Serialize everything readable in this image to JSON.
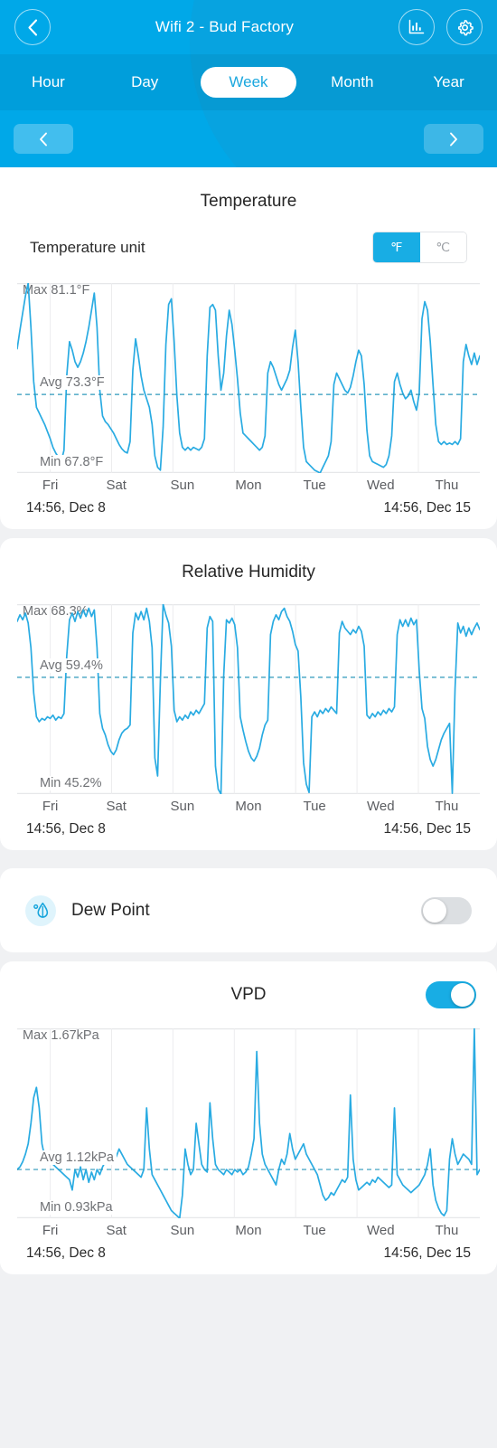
{
  "header": {
    "title": "Wifi 2 - Bud Factory",
    "back_icon": "chevron-left-icon",
    "stats_icon": "bar-chart-icon",
    "settings_icon": "gear-icon",
    "accent": "#00a8e8"
  },
  "tabs": [
    {
      "label": "Hour",
      "active": false
    },
    {
      "label": "Day",
      "active": false
    },
    {
      "label": "Week",
      "active": true
    },
    {
      "label": "Month",
      "active": false
    },
    {
      "label": "Year",
      "active": false
    }
  ],
  "date_nav": {
    "prev_icon": "chevron-left-icon",
    "next_icon": "chevron-right-icon"
  },
  "temperature": {
    "title": "Temperature",
    "unit_label": "Temperature unit",
    "unit_options": [
      {
        "label": "℉",
        "selected": true
      },
      {
        "label": "℃",
        "selected": false
      }
    ],
    "max": "Max 81.1°F",
    "avg": "Avg 73.3°F",
    "min": "Min 67.8°F",
    "start_stamp": "14:56,  Dec 8",
    "end_stamp": "14:56,  Dec 15"
  },
  "humidity": {
    "title": "Relative Humidity",
    "max": "Max 68.3%",
    "avg": "Avg 59.4%",
    "min": "Min 45.2%",
    "start_stamp": "14:56,  Dec 8",
    "end_stamp": "14:56,  Dec 15"
  },
  "dew_point": {
    "label": "Dew Point",
    "icon": "dew-drop-icon",
    "enabled": false
  },
  "vpd": {
    "title": "VPD",
    "enabled": true,
    "max": "Max 1.67kPa",
    "avg": "Avg 1.12kPa",
    "min": "Min 0.93kPa",
    "start_stamp": "14:56,  Dec 8",
    "end_stamp": "14:56,  Dec 15"
  },
  "day_labels": [
    "Fri",
    "Sat",
    "Sun",
    "Mon",
    "Tue",
    "Wed",
    "Thu"
  ],
  "chart_data": [
    {
      "id": "temperature",
      "type": "line",
      "title": "Temperature",
      "unit": "°F",
      "xlabel": "",
      "ylabel": "",
      "x_tick_labels": [
        "Fri",
        "Sat",
        "Sun",
        "Mon",
        "Tue",
        "Wed",
        "Thu"
      ],
      "x_range": [
        "14:56, Dec 8",
        "14:56, Dec 15"
      ],
      "max": 81.1,
      "avg": 73.3,
      "min": 67.8,
      "ylim": [
        67.8,
        81.1
      ],
      "grid": true,
      "avg_line": true,
      "legend": "none",
      "line_color": "#29ABE2",
      "values": [
        76.5,
        77.8,
        79.0,
        80.2,
        81.1,
        78.0,
        74.2,
        72.4,
        72.0,
        71.6,
        71.2,
        70.7,
        70.2,
        69.6,
        69.2,
        68.9,
        68.6,
        69.4,
        74.6,
        77.0,
        76.4,
        75.6,
        75.2,
        75.6,
        76.2,
        77.0,
        78.0,
        79.2,
        80.4,
        78.0,
        73.6,
        71.8,
        71.4,
        71.2,
        70.9,
        70.6,
        70.2,
        69.8,
        69.5,
        69.3,
        69.2,
        70.0,
        75.0,
        77.2,
        76.0,
        74.6,
        73.6,
        73.0,
        72.4,
        71.2,
        69.0,
        68.2,
        68.0,
        71.0,
        76.8,
        79.6,
        80.0,
        77.0,
        73.2,
        70.6,
        69.6,
        69.4,
        69.6,
        69.4,
        69.6,
        69.5,
        69.4,
        69.6,
        70.2,
        76.0,
        79.4,
        79.6,
        79.2,
        76.0,
        73.6,
        74.8,
        77.4,
        79.2,
        78.2,
        76.4,
        74.4,
        72.0,
        70.6,
        70.4,
        70.2,
        70.0,
        69.8,
        69.6,
        69.4,
        69.6,
        70.4,
        74.8,
        75.6,
        75.2,
        74.6,
        74.0,
        73.6,
        74.0,
        74.4,
        75.0,
        76.6,
        77.8,
        75.6,
        72.4,
        69.6,
        68.6,
        68.4,
        68.2,
        68.0,
        67.9,
        67.8,
        68.2,
        68.6,
        69.0,
        70.0,
        74.0,
        74.8,
        74.4,
        74.0,
        73.6,
        73.4,
        73.8,
        74.6,
        75.6,
        76.4,
        76.0,
        74.0,
        70.8,
        69.0,
        68.6,
        68.5,
        68.4,
        68.3,
        68.2,
        68.4,
        69.0,
        70.4,
        74.2,
        74.8,
        74.0,
        73.4,
        73.0,
        73.2,
        73.6,
        72.8,
        72.2,
        73.4,
        78.6,
        79.8,
        79.2,
        77.0,
        74.0,
        71.2,
        70.0,
        69.8,
        70.0,
        69.8,
        69.9,
        69.8,
        70.0,
        69.8,
        70.2,
        75.6,
        76.8,
        76.0,
        75.4,
        76.2,
        75.4,
        76.0
      ]
    },
    {
      "id": "relative_humidity",
      "type": "line",
      "title": "Relative Humidity",
      "unit": "%",
      "xlabel": "",
      "ylabel": "",
      "x_tick_labels": [
        "Fri",
        "Sat",
        "Sun",
        "Mon",
        "Tue",
        "Wed",
        "Thu"
      ],
      "x_range": [
        "14:56, Dec 8",
        "14:56, Dec 15"
      ],
      "max": 68.3,
      "avg": 59.4,
      "min": 45.2,
      "ylim": [
        45.2,
        68.3
      ],
      "grid": true,
      "avg_line": true,
      "legend": "none",
      "line_color": "#29ABE2",
      "values": [
        66.2,
        67.0,
        66.4,
        67.2,
        66.0,
        63.0,
        57.5,
        54.6,
        54.0,
        54.4,
        54.2,
        54.6,
        54.4,
        54.8,
        54.2,
        54.6,
        54.4,
        55.0,
        62.0,
        66.4,
        67.2,
        66.2,
        67.4,
        66.6,
        67.6,
        66.8,
        67.8,
        66.8,
        67.6,
        63.0,
        55.0,
        53.2,
        52.4,
        51.2,
        50.4,
        50.0,
        50.6,
        51.8,
        52.6,
        53.0,
        53.2,
        53.6,
        64.8,
        67.2,
        66.4,
        67.4,
        66.4,
        67.8,
        66.2,
        63.0,
        49.6,
        47.4,
        59.0,
        68.3,
        67.0,
        66.0,
        63.2,
        55.4,
        54.0,
        54.6,
        54.2,
        54.8,
        54.4,
        55.2,
        54.8,
        55.4,
        55.0,
        55.6,
        56.2,
        65.4,
        66.8,
        66.2,
        48.6,
        45.8,
        45.2,
        59.6,
        66.4,
        66.0,
        66.6,
        65.8,
        63.0,
        54.6,
        53.0,
        51.6,
        50.4,
        49.6,
        49.2,
        49.8,
        50.8,
        52.4,
        53.6,
        54.2,
        64.6,
        66.2,
        67.0,
        66.4,
        67.4,
        67.8,
        66.8,
        66.2,
        65.0,
        63.4,
        62.6,
        57.0,
        49.0,
        46.4,
        45.4,
        54.6,
        55.2,
        54.6,
        55.4,
        55.0,
        55.6,
        55.2,
        55.8,
        55.4,
        55.0,
        64.8,
        66.2,
        65.4,
        65.0,
        64.6,
        65.2,
        64.8,
        65.6,
        65.0,
        63.2,
        54.8,
        54.4,
        55.0,
        54.6,
        55.2,
        54.8,
        55.4,
        55.0,
        55.6,
        55.2,
        55.8,
        64.6,
        66.4,
        65.6,
        66.4,
        65.6,
        66.6,
        65.8,
        66.4,
        60.2,
        55.6,
        54.4,
        51.0,
        49.4,
        48.6,
        49.4,
        50.6,
        51.8,
        52.6,
        53.2,
        53.8,
        45.3,
        58.0,
        66.0,
        64.8,
        65.6,
        64.4,
        65.4,
        64.6,
        65.4,
        66.0,
        65.2
      ]
    },
    {
      "id": "vpd",
      "type": "line",
      "title": "VPD",
      "unit": "kPa",
      "xlabel": "",
      "ylabel": "",
      "x_tick_labels": [
        "Fri",
        "Sat",
        "Sun",
        "Mon",
        "Tue",
        "Wed",
        "Thu"
      ],
      "x_range": [
        "14:56, Dec 8",
        "14:56, Dec 15"
      ],
      "max": 1.67,
      "avg": 1.12,
      "min": 0.93,
      "ylim": [
        0.93,
        1.67
      ],
      "grid": true,
      "avg_line": true,
      "legend": "none",
      "line_color": "#29ABE2",
      "values": [
        1.12,
        1.13,
        1.15,
        1.18,
        1.22,
        1.3,
        1.4,
        1.44,
        1.36,
        1.22,
        1.17,
        1.16,
        1.15,
        1.14,
        1.13,
        1.12,
        1.11,
        1.1,
        1.09,
        1.08,
        1.04,
        1.12,
        1.09,
        1.13,
        1.08,
        1.12,
        1.07,
        1.11,
        1.08,
        1.12,
        1.1,
        1.13,
        1.15,
        1.18,
        1.16,
        1.19,
        1.17,
        1.2,
        1.18,
        1.16,
        1.14,
        1.13,
        1.12,
        1.11,
        1.1,
        1.09,
        1.12,
        1.36,
        1.2,
        1.1,
        1.08,
        1.06,
        1.04,
        1.02,
        1.0,
        0.98,
        0.96,
        0.95,
        0.94,
        0.93,
        1.02,
        1.2,
        1.14,
        1.1,
        1.12,
        1.3,
        1.22,
        1.14,
        1.12,
        1.11,
        1.38,
        1.24,
        1.14,
        1.12,
        1.11,
        1.1,
        1.12,
        1.11,
        1.1,
        1.12,
        1.11,
        1.12,
        1.1,
        1.11,
        1.13,
        1.18,
        1.24,
        1.58,
        1.3,
        1.18,
        1.14,
        1.12,
        1.1,
        1.08,
        1.06,
        1.12,
        1.16,
        1.14,
        1.18,
        1.26,
        1.2,
        1.16,
        1.18,
        1.2,
        1.22,
        1.18,
        1.16,
        1.14,
        1.12,
        1.1,
        1.06,
        1.02,
        1.0,
        1.01,
        1.03,
        1.02,
        1.04,
        1.06,
        1.08,
        1.07,
        1.09,
        1.41,
        1.16,
        1.08,
        1.04,
        1.05,
        1.06,
        1.07,
        1.06,
        1.08,
        1.07,
        1.09,
        1.08,
        1.07,
        1.06,
        1.05,
        1.06,
        1.36,
        1.1,
        1.08,
        1.06,
        1.05,
        1.04,
        1.03,
        1.04,
        1.05,
        1.06,
        1.08,
        1.1,
        1.14,
        1.2,
        1.06,
        1.0,
        0.97,
        0.95,
        0.94,
        0.96,
        1.16,
        1.24,
        1.18,
        1.14,
        1.16,
        1.18,
        1.17,
        1.16,
        1.14,
        1.67,
        1.1,
        1.12
      ]
    }
  ]
}
